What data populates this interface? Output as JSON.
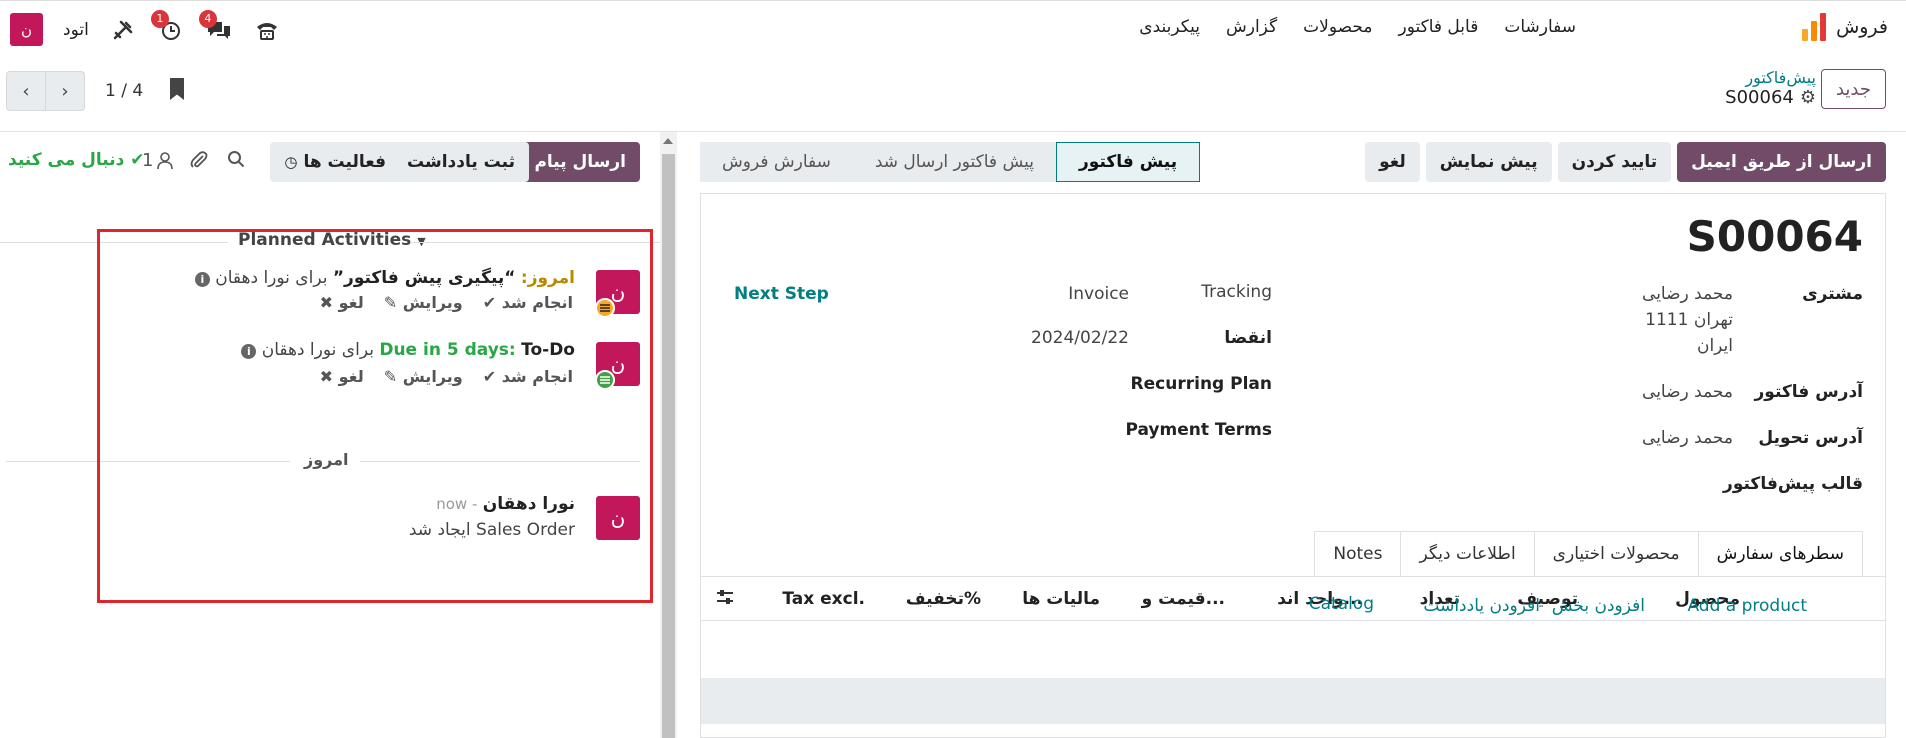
{
  "navbar": {
    "app_name": "فروش",
    "menu": [
      "سفارشات",
      "قابل فاکتور",
      "محصولات",
      "گزارش",
      "پیکربندی"
    ],
    "company": "اتود",
    "avatar_letter": "ن",
    "activity_badge": "1",
    "messages_badge": "4"
  },
  "control": {
    "new_button": "جدید",
    "breadcrumb_parent": "پیش‌فاکتور",
    "record_name": "S00064",
    "pager_value": "1 / 4"
  },
  "statusbar": {
    "buttons": [
      "ارسال از طریق ایمیل",
      "تایید کردن",
      "پیش نمایش",
      "لغو"
    ],
    "stages": [
      "پیش فاکتور",
      "پیش فاکتور ارسال شد",
      "سفارش فروش"
    ],
    "active_stage": "پیش فاکتور"
  },
  "form": {
    "name": "S00064",
    "customer_label": "مشتری",
    "customer_name": "محمد رضایی",
    "customer_city": "تهران 1111",
    "customer_country": "ایران",
    "invoice_address_label": "آدرس فاکتور",
    "invoice_address": "محمد رضایی",
    "delivery_address_label": "آدرس تحویل",
    "delivery_address": "محمد رضایی",
    "template_label": "قالب پیش‌فاکتور",
    "tracking_label": "Tracking",
    "tracking_value": "Invoice",
    "next_step": "Next Step",
    "expiration_label": "انقضا",
    "expiration_value": "2024/02/22",
    "recurring_label": "Recurring Plan",
    "payment_terms_label": "Payment Terms"
  },
  "tabs": [
    "سطرهای سفارش",
    "محصولات اختیاری",
    "اطلاعات دیگر",
    "Notes"
  ],
  "order_lines": {
    "columns": [
      "محصول",
      "توصیف",
      "تعداد",
      "واحد اند...",
      "قیمت و...",
      "مالیات ها",
      "تخفیف%",
      "Tax excl."
    ],
    "add_product": "Add a product",
    "add_section": "افزودن بخش",
    "add_note": "افزودن یادداشت",
    "catalog": "Catalog"
  },
  "chatter": {
    "send_message": "ارسال پیام",
    "log_note": "ثبت یادداشت",
    "activities": "فعالیت ها",
    "followers_count": "1",
    "following": "دنبال می کنید",
    "planned_activities": "Planned Activities",
    "activities_list": [
      {
        "due": "امروز:",
        "summary": "“پیگیری پیش فاکتور”",
        "assignee": "برای نورا دهقان",
        "done": "انجام شد",
        "edit": "ویرایش",
        "cancel": "لغو"
      },
      {
        "type": "To-Do",
        "due": "Due in 5 days:",
        "assignee": "برای نورا دهقان",
        "done": "انجام شد",
        "edit": "ویرایش",
        "cancel": "لغو"
      }
    ],
    "today_separator": "امروز",
    "message": {
      "author": "نورا دهقان",
      "time": "now",
      "body": "Sales Order ایجاد شد"
    }
  },
  "colors": {
    "primary": "#714b67",
    "link": "#017e84",
    "avatar": "#c2185b",
    "success": "#28a745",
    "due_today": "#b88a00",
    "due_future": "#28a745",
    "highlight": "#e0262d"
  }
}
